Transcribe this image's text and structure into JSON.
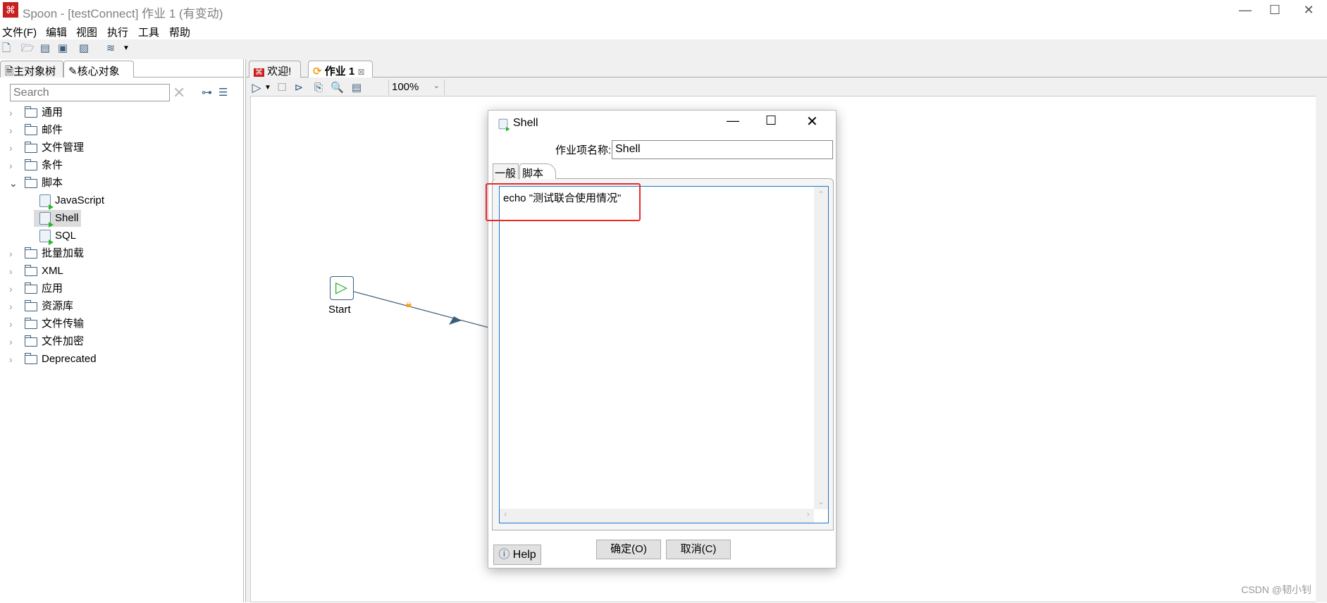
{
  "window": {
    "title": "Spoon - [testConnect] 作业 1 (有变动)",
    "controls": [
      "—",
      "☐",
      "✕"
    ]
  },
  "menu": [
    "文件(F)",
    "编辑",
    "视图",
    "执行",
    "工具",
    "帮助"
  ],
  "left_panel": {
    "tabs": [
      "主对象树",
      "核心对象"
    ],
    "search_placeholder": "Search",
    "tree": [
      {
        "label": "通用",
        "expanded": false
      },
      {
        "label": "邮件",
        "expanded": false
      },
      {
        "label": "文件管理",
        "expanded": false
      },
      {
        "label": "条件",
        "expanded": false
      },
      {
        "label": "脚本",
        "expanded": true,
        "children": [
          {
            "label": "JavaScript"
          },
          {
            "label": "Shell",
            "selected": true
          },
          {
            "label": "SQL"
          }
        ]
      },
      {
        "label": "批量加载",
        "expanded": false
      },
      {
        "label": "XML",
        "expanded": false
      },
      {
        "label": "应用",
        "expanded": false
      },
      {
        "label": "资源库",
        "expanded": false
      },
      {
        "label": "文件传输",
        "expanded": false
      },
      {
        "label": "文件加密",
        "expanded": false
      },
      {
        "label": "Deprecated",
        "expanded": false
      }
    ]
  },
  "editor": {
    "tabs": [
      "欢迎!",
      "作业 1"
    ],
    "zoom": "100%",
    "canvas": {
      "start_label": "Start"
    }
  },
  "dialog": {
    "title": "Shell",
    "name_label": "作业项名称:",
    "name_value": "Shell",
    "tabs": [
      "一般",
      "脚本"
    ],
    "active_tab": "脚本",
    "script": "echo \"测试联合使用情况\"",
    "ok": "确定(O)",
    "cancel": "取消(C)",
    "help": "Help",
    "highlight_color": "#e82a2a"
  },
  "watermark": "CSDN @韧小钊"
}
